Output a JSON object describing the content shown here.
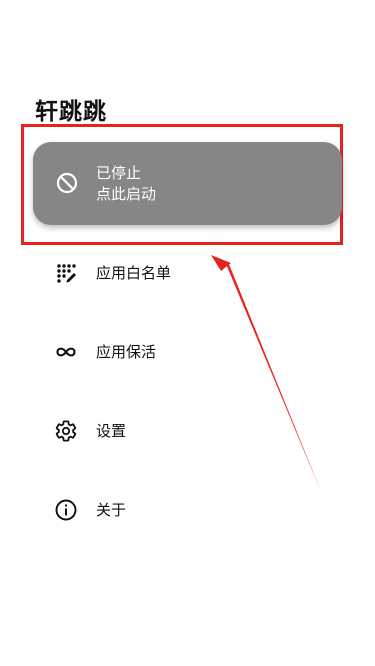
{
  "app": {
    "title": "轩跳跳"
  },
  "status_card": {
    "icon": "block-icon",
    "line1": "已停止",
    "line2": "点此启动"
  },
  "menu": [
    {
      "label": "应用白名单",
      "icon": "dots-grid-icon"
    },
    {
      "label": "应用保活",
      "icon": "infinity-icon"
    },
    {
      "label": "设置",
      "icon": "gear-icon"
    },
    {
      "label": "关于",
      "icon": "info-icon"
    }
  ],
  "colors": {
    "card_background": "#868686",
    "highlight": "#e8231d",
    "text": "#111111"
  }
}
